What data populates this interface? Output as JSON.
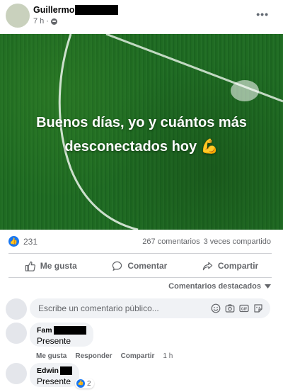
{
  "post": {
    "author_name": "Guillermo",
    "time": "7 h",
    "more_label": "•••",
    "image_text_line1": "Buenos días, yo y cuántos más",
    "image_text_line2": "desconectados hoy",
    "image_emoji": "💪"
  },
  "stats": {
    "reactions_count": "231",
    "comments_count": "267 comentarios",
    "shares_count": "3 veces compartido"
  },
  "actions": {
    "like": "Me gusta",
    "comment": "Comentar",
    "share": "Compartir"
  },
  "comments_filter": "Comentarios destacados",
  "composer": {
    "placeholder": "Escribe un comentario público..."
  },
  "comments": [
    {
      "name": "Fam",
      "text": "Presente",
      "like_label": "Me gusta",
      "reply_label": "Responder",
      "share_label": "Compartir",
      "time": "1 h"
    },
    {
      "name": "Edwin",
      "text": "Presente",
      "reaction_count": "2"
    }
  ],
  "colors": {
    "accent": "#1877f2",
    "muted_text": "#65676b",
    "bubble": "#f0f2f5",
    "grass": "#216b25"
  },
  "icons": [
    "globe-icon",
    "more-icon",
    "like-icon",
    "comment-icon",
    "share-icon",
    "chevron-down-icon",
    "emoji-icon",
    "camera-icon",
    "gif-icon",
    "sticker-icon"
  ]
}
